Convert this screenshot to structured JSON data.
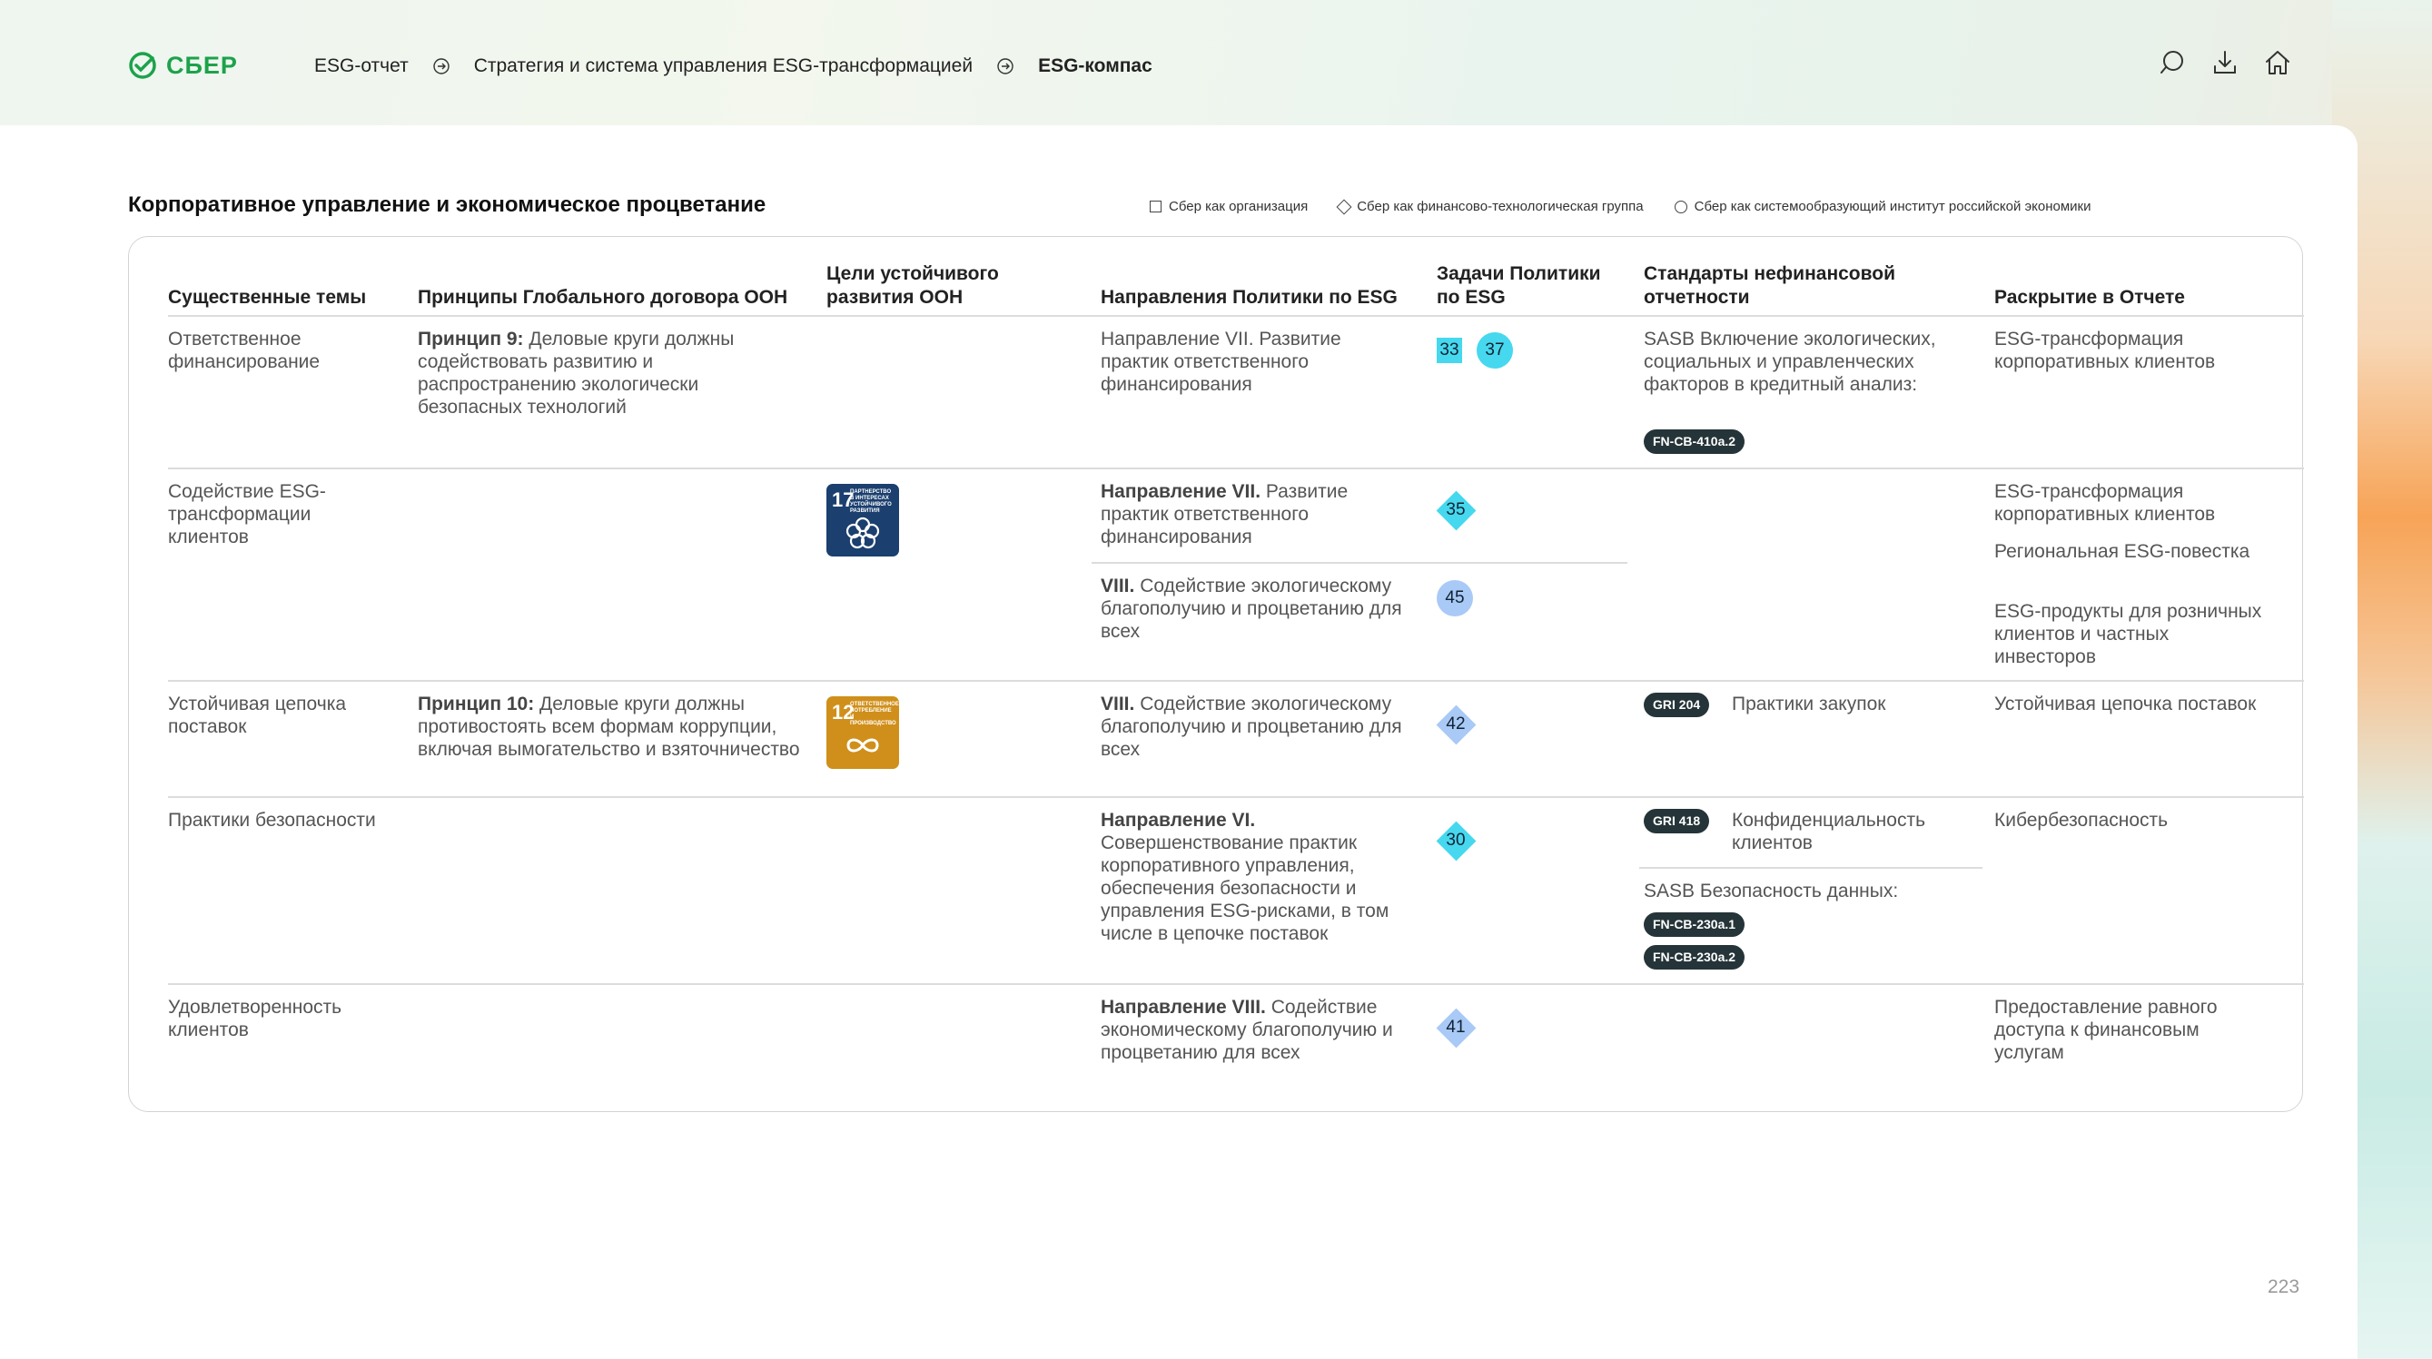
{
  "brand": {
    "name": "СБЕР",
    "color": "#1ca24b"
  },
  "breadcrumbs": [
    "ESG-отчет",
    "Стратегия и система управления ESG-трансформацией",
    "ESG-компас"
  ],
  "tools": {
    "search_icon": "search-icon",
    "download_icon": "download-icon",
    "home_icon": "home-icon"
  },
  "section_title": "Корпоративное управление и экономическое процветание",
  "legend": [
    {
      "shape": "square",
      "label": "Сбер как организация"
    },
    {
      "shape": "diamond",
      "label": "Сбер как финансово-технологическая группа"
    },
    {
      "shape": "circle",
      "label": "Сбер как системообразующий институт российской экономики"
    }
  ],
  "columns": [
    "Существенные темы",
    "Принципы Глобального договора ООН",
    "Цели устойчивого развития ООН",
    "Направления Политики по ESG",
    "Задачи Политики по ESG",
    "Стандарты нефинансовой отчетности",
    "Раскрытие в Отчете"
  ],
  "rows": [
    {
      "topic": "Ответственное финансирование",
      "principle_bold": "Принцип 9:",
      "principle_rest": " Деловые круги должны содействовать развитию и распространению экологически безопасных технологий",
      "direction": "Направление VII. Развитие практик ответственного финансирования",
      "tasks": [
        "33",
        "37"
      ],
      "standard_text": "SASB Включение экологических, социальных и управленческих факторов в кредитный анализ:",
      "standard_badge": "FN-CB-410a.2",
      "disclosure": "ESG-трансформация корпоративных клиентов"
    },
    {
      "topic": "Содействие ESG-трансформации клиентов",
      "sdg": {
        "number": "17",
        "title": "Партнерство в интересах устойчивого развития",
        "color": "#1b3f6e"
      },
      "direction1_bold": "Направление VII.",
      "direction1_rest": " Развитие практик ответственного финансирования",
      "task1": "35",
      "direction2_bold": "VIII.",
      "direction2_rest": " Содействие экологическому благополучию и процветанию для всех",
      "task2": "45",
      "disclosures": [
        "ESG-трансформация корпоративных клиентов",
        "Региональная ESG-повестка",
        "ESG-продукты для розничных клиентов и частных инвесторов"
      ]
    },
    {
      "topic": "Устойчивая цепочка поставок",
      "principle_bold": "Принцип 10:",
      "principle_rest": " Деловые круги должны противостоять всем формам коррупции, включая вымогательство и взяточничество",
      "sdg": {
        "number": "12",
        "title": "Ответственное потребление и производство",
        "color": "#d08f1a"
      },
      "direction_bold": "VIII.",
      "direction_rest": " Содействие экологическому благополучию и процветанию для всех",
      "task": "42",
      "standard_badge": "GRI 204",
      "standard_text": "Практики закупок",
      "disclosure": "Устойчивая цепочка поставок"
    },
    {
      "topic": "Практики безопасности",
      "direction_bold": "Направление VI.",
      "direction_rest": " Совершенствование практик корпоративного управления, обеспечения безопасности и управления ESG-рисками, в том числе в цепочке поставок",
      "task": "30",
      "standard1_badge": "GRI 418",
      "standard1_text": "Конфиденциальность клиентов",
      "standard2_text": "SASB Безопасность данных:",
      "standard2_badges": [
        "FN-CB-230a.1",
        "FN-CB-230a.2"
      ],
      "disclosure": "Кибербезопасность"
    },
    {
      "topic": "Удовлетворенность клиентов",
      "direction_bold": "Направление VIII.",
      "direction_rest": " Содействие экономическому благополучию и процветанию для всех",
      "task": "41",
      "disclosure": "Предоставление равного доступа к финансовым услугам"
    }
  ],
  "colors": {
    "task_cyan": "#46d8ee",
    "task_blue": "#a9c9f6",
    "badge_dark": "#253438"
  },
  "page_number": "223"
}
